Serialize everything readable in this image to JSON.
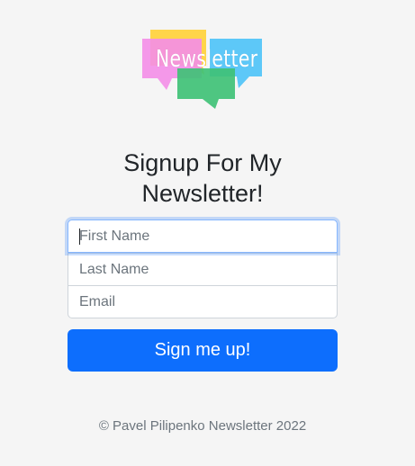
{
  "logo": {
    "word": "Newsletter"
  },
  "heading": "Signup For My Newsletter!",
  "form": {
    "first_name_placeholder": "First Name",
    "last_name_placeholder": "Last Name",
    "email_placeholder": "Email",
    "submit_label": "Sign me up!"
  },
  "footer": {
    "text": "© Pavel Pilipenko Newsletter 2022"
  },
  "colors": {
    "background": "#f5f5f5",
    "primary": "#0d6efd",
    "logo_yellow": "#ffd54a",
    "logo_pink": "#f48ee8",
    "logo_cyan": "#4fc3f7",
    "logo_green": "#3fc176"
  }
}
